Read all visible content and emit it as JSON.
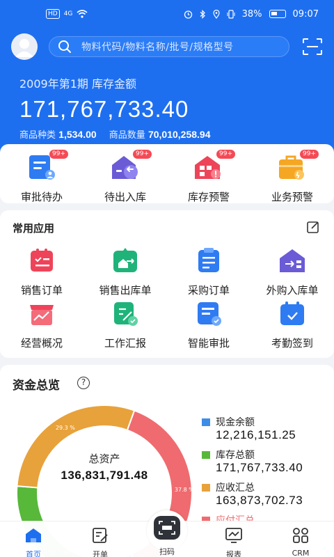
{
  "status_bar": {
    "left": [
      "HD",
      "4G"
    ],
    "battery": "38%",
    "time": "09:07"
  },
  "search": {
    "placeholder": "物料代码/物料名称/批号/规格型号"
  },
  "summary": {
    "period": "2009年第1期 库存金额",
    "amount": "171,767,733.40",
    "kinds_label": "商品种类",
    "kinds_value": "1,534.00",
    "qty_label": "商品数量",
    "qty_value": "70,010,258.94"
  },
  "todo": [
    {
      "label": "审批待办",
      "badge": "99+",
      "icon": "approval-icon",
      "color": "#2f7bf2"
    },
    {
      "label": "待出入库",
      "badge": "99+",
      "icon": "warehouse-in-out-icon",
      "color": "#6b5bd6"
    },
    {
      "label": "库存预警",
      "badge": "99+",
      "icon": "stock-warning-icon",
      "color": "#ee4459"
    },
    {
      "label": "业务预警",
      "badge": "99+",
      "icon": "business-warning-icon",
      "color": "#f5a623"
    }
  ],
  "apps": {
    "title": "常用应用",
    "items": [
      {
        "label": "销售订单",
        "icon": "sales-order-icon",
        "color": "#ee4459"
      },
      {
        "label": "销售出库单",
        "icon": "sales-outbound-icon",
        "color": "#1fb37a"
      },
      {
        "label": "采购订单",
        "icon": "purchase-order-icon",
        "color": "#2f7bf2"
      },
      {
        "label": "外购入库单",
        "icon": "purchase-inbound-icon",
        "color": "#6b5bd6"
      },
      {
        "label": "经营概况",
        "icon": "business-overview-icon",
        "color": "#ee4459"
      },
      {
        "label": "工作汇报",
        "icon": "work-report-icon",
        "color": "#1fb37a"
      },
      {
        "label": "智能审批",
        "icon": "smart-approval-icon",
        "color": "#2f7bf2"
      },
      {
        "label": "考勤签到",
        "icon": "attendance-icon",
        "color": "#2f7bf2"
      }
    ]
  },
  "funds": {
    "title": "资金总览",
    "help": "?",
    "center_label": "总资产",
    "center_value": "136,831,791.48"
  },
  "chart_data": {
    "type": "pie",
    "title": "资金总览",
    "series": [
      {
        "name": "现金余额",
        "value": "12,216,151.25",
        "percent": 2.2,
        "color": "#3d8de8"
      },
      {
        "name": "库存总额",
        "value": "171,767,733.40",
        "percent": 30.7,
        "color": "#57b83a"
      },
      {
        "name": "应收汇总",
        "value": "163,873,702.73",
        "percent": 29.3,
        "color": "#e8a23b"
      },
      {
        "name": "应付汇总",
        "value": "",
        "percent": 37.8,
        "color": "#ef6b6f"
      }
    ],
    "percent_labels": [
      "2.2 %",
      "30.7 %",
      "29.3 %",
      "37.8 %"
    ]
  },
  "tabs": [
    {
      "label": "首页",
      "icon": "home-icon",
      "active": true
    },
    {
      "label": "开单",
      "icon": "order-icon",
      "active": false
    },
    {
      "label": "扫码",
      "icon": "scan-icon",
      "active": false
    },
    {
      "label": "报表",
      "icon": "report-icon",
      "active": false
    },
    {
      "label": "CRM",
      "icon": "crm-icon",
      "active": false
    }
  ]
}
